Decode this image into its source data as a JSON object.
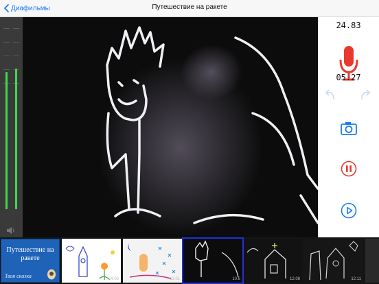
{
  "nav": {
    "back_label": "Диафильмы",
    "title": "Путешествие на ракете"
  },
  "recorder": {
    "elapsed": "24.83",
    "remaining": "05.27"
  },
  "filmstrip": {
    "cover_title": "Путешествие на ракете",
    "cover_subtitle": "Твоя сказка",
    "frames": [
      {
        "label": "24.06"
      },
      {
        "label": "11.01"
      },
      {
        "label": "10.6"
      },
      {
        "label": "12.08"
      },
      {
        "label": "12.11"
      }
    ]
  },
  "colors": {
    "accent": "#1a7cf0",
    "record": "#e8392f",
    "meter": "#3ddc4a",
    "strip_bg": "#151515"
  }
}
